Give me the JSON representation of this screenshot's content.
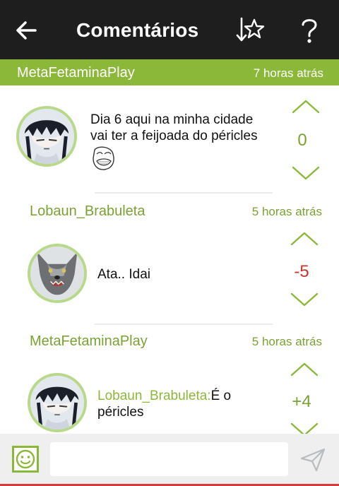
{
  "topbar": {
    "title": "Comentários",
    "back_icon": "arrow-left-icon",
    "sort_icon": "sort-star-icon",
    "help_icon": "question-mark-icon"
  },
  "comment": {
    "user": "MetaFetaminaPlay",
    "time": "7 horas atrás",
    "text_line1": "Dia 6 aqui na minha cidade",
    "text_line2": "vai ter a feijoada do péricles",
    "meme": "sweet-jesus-meme-face",
    "score": "0"
  },
  "replies": [
    {
      "user": "Lobaun_Brabuleta",
      "time": "5 horas atrás",
      "text": "Ata.. Idai",
      "score": "-5"
    },
    {
      "user": "MetaFetaminaPlay",
      "time": "5 horas atrás",
      "mention": "Lobaun_Brabuleta:",
      "text_after_mention": "É o",
      "text_line2": "péricles",
      "score": "+4"
    }
  ],
  "composer": {
    "input_value": "",
    "emoji_icon": "smiley-icon",
    "send_icon": "paper-plane-icon"
  },
  "colors": {
    "topbar": "#1e1e1e",
    "accent_green": "#8cb83a",
    "negative_red": "#c9342c",
    "bottom_line": "#d93a3a"
  }
}
